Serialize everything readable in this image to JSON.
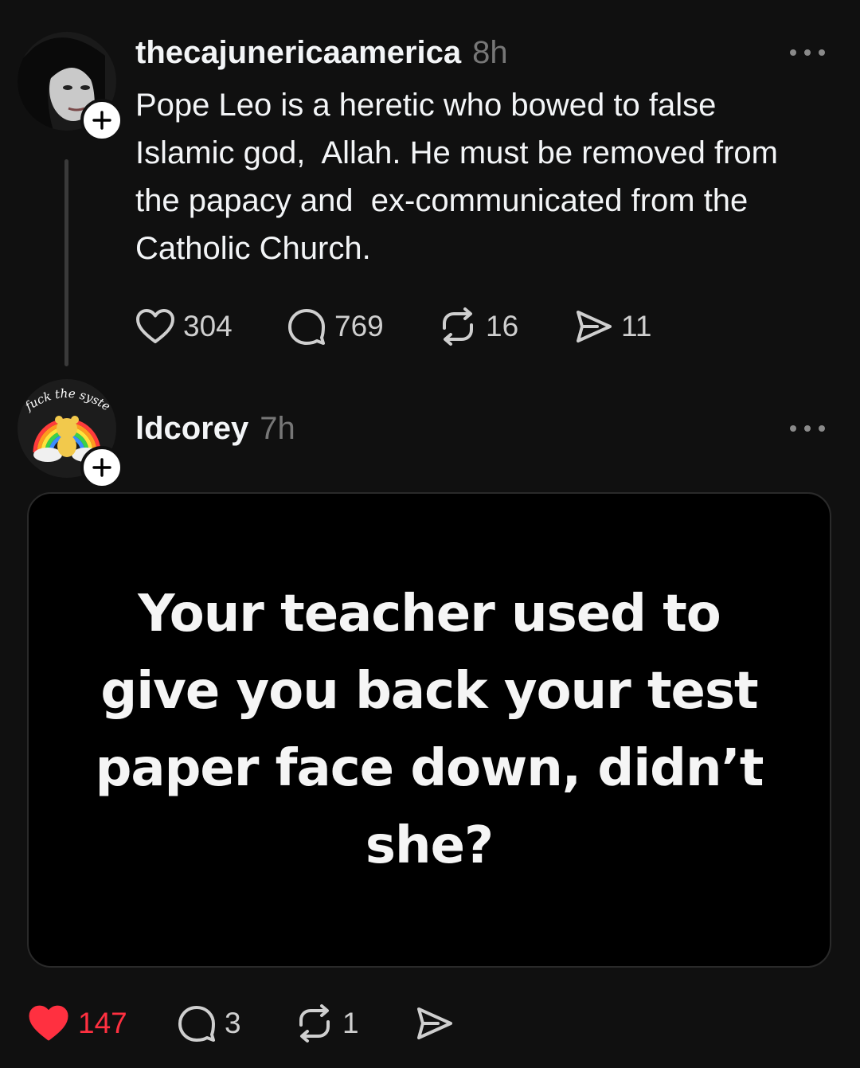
{
  "posts": [
    {
      "username": "thecajunericaamerica",
      "timestamp": "8h",
      "text": "Pope Leo is a heretic who bowed to false\nIslamic god,  Allah. He must be removed from\nthe papacy and  ex-communicated from the\nCatholic Church.",
      "stats": {
        "likes": "304",
        "replies": "769",
        "reposts": "16",
        "shares": "11"
      },
      "liked": false
    },
    {
      "username": "ldcorey",
      "timestamp": "7h",
      "avatar_text": "fuck the system",
      "image_text": "Your teacher used to give you back your test paper face down, didn’t she?",
      "stats": {
        "likes": "147",
        "replies": "3",
        "reposts": "1",
        "shares": ""
      },
      "liked": true
    }
  ],
  "icons": {
    "like": "heart-icon",
    "reply": "speech-bubble-icon",
    "repost": "repost-arrows-icon",
    "share": "paper-plane-icon",
    "more": "ellipsis-icon",
    "follow": "plus-icon"
  },
  "colors": {
    "background": "#101010",
    "text": "#f3f5f7",
    "secondary": "#777777",
    "like_active": "#ff3040"
  }
}
